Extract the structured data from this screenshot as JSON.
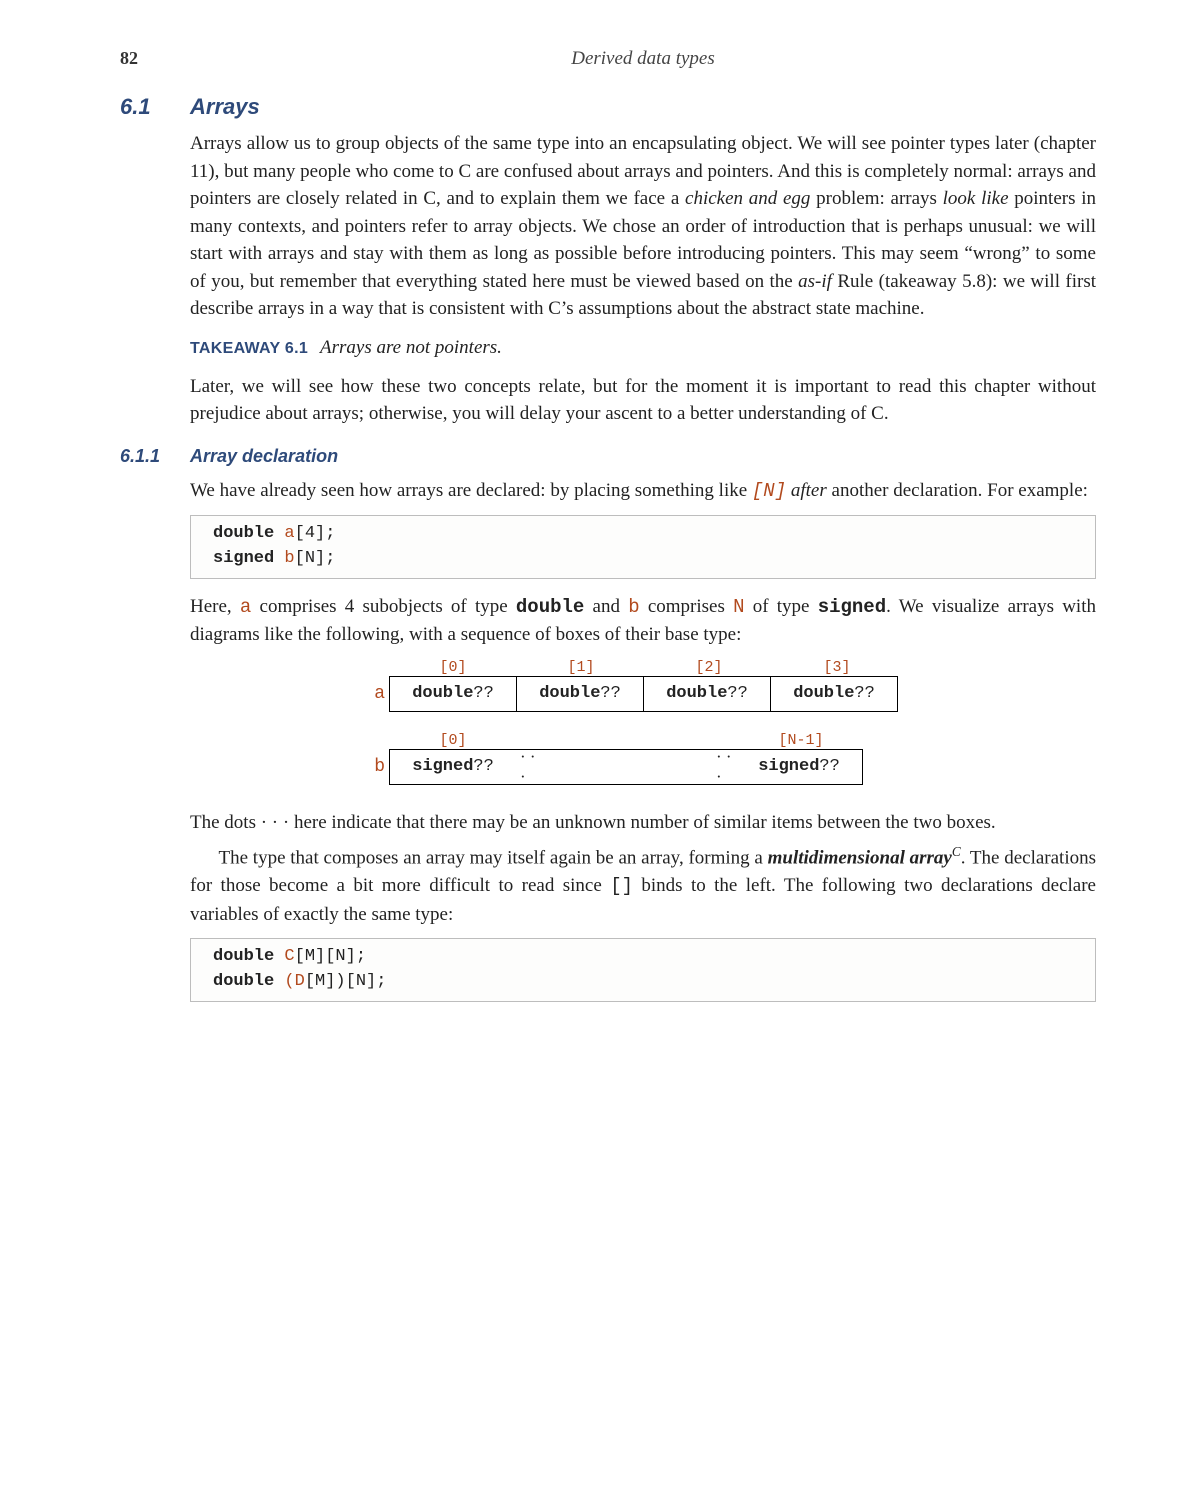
{
  "header": {
    "page_number": "82",
    "chapter_label": "Derived data types"
  },
  "section": {
    "number": "6.1",
    "title": "Arrays",
    "para1_part1": "Arrays allow us to group objects of the same type into an encapsulating object. We will see pointer types later (chapter 11), but many people who come to C are confused about arrays and pointers. And this is completely normal: arrays and pointers are closely related in C, and to explain them we face a ",
    "para1_em1": "chicken and egg",
    "para1_part2": " problem: arrays ",
    "para1_em2": "look like",
    "para1_part3": " pointers in many contexts, and pointers refer to array objects. We chose an order of introduction that is perhaps unusual: we will start with arrays and stay with them as long as possible before introducing pointers. This may seem “wrong” to some of you, but remember that everything stated here must be viewed based on the ",
    "para1_em3": "as-if",
    "para1_part4": " Rule (takeaway 5.8): we will first describe arrays in a way that is consistent with C’s assumptions about the abstract state machine.",
    "takeaway_label": "TAKEAWAY 6.1",
    "takeaway_text": "Arrays are not pointers.",
    "para2": "Later, we will see how these two concepts relate, but for the moment it is important to read this chapter without prejudice about arrays; otherwise, you will delay your ascent to a better understanding of C."
  },
  "subsection": {
    "number": "6.1.1",
    "title": "Array declaration",
    "para1_part1": "We have already seen how arrays are declared: by placing something like ",
    "para1_code": "[N]",
    "para1_em": " after",
    "para1_part2": " another declaration. For example:",
    "code1_kw1": "double",
    "code1_var1": "a",
    "code1_rest1": "[4];",
    "code1_kw2": "signed",
    "code1_var2": "b",
    "code1_rest2": "[N];",
    "para2_a": "Here, ",
    "para2_var_a": "a",
    "para2_b": " comprises 4 subobjects of type ",
    "para2_kw_double": "double",
    "para2_c": " and ",
    "para2_var_b": "b",
    "para2_d": " comprises ",
    "para2_var_N": "N",
    "para2_e": " of type ",
    "para2_kw_signed": "signed",
    "para2_f": ". We visualize arrays with diagrams like the following, with a sequence of boxes of their base type:",
    "diagram": {
      "a_label": "a",
      "a_indices": [
        "[0]",
        "[1]",
        "[2]",
        "[3]"
      ],
      "a_cell_kw": "double",
      "a_cell_val": " ??",
      "b_label": "b",
      "b_index0": "[0]",
      "b_indexN": "[N-1]",
      "b_cell_kw": "signed",
      "b_cell_val": " ??",
      "dots": "· · ·"
    },
    "para3_a": "The dots ",
    "para3_dots": "· · ·",
    "para3_b": " here indicate that there may be an unknown number of similar items between the two boxes.",
    "para4_a": "The type that composes an array may itself again be an array, forming a ",
    "para4_strong": "multidimensional array",
    "para4_sup": "C",
    "para4_b": ". The declarations for those become a bit more difficult to read since ",
    "para4_code": "[]",
    "para4_c": " binds to the left. The following two declarations declare variables of exactly the same type:",
    "code2_kw1": "double",
    "code2_var1": "C",
    "code2_rest1": "[M][N];",
    "code2_kw2": "double",
    "code2_var2a": "(",
    "code2_var2b": "D",
    "code2_rest2": "[M])[N];"
  }
}
